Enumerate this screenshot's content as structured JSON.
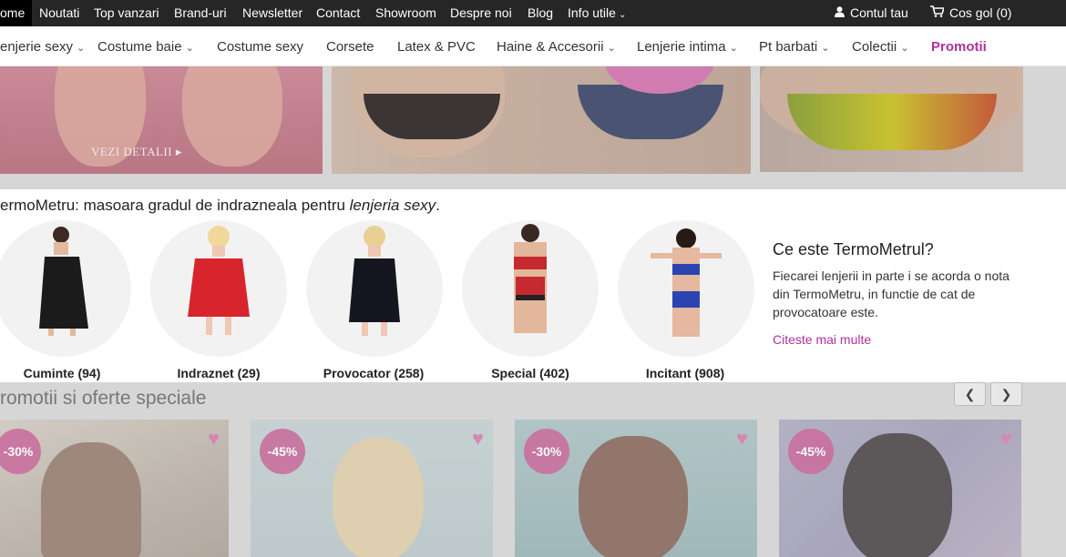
{
  "topbar": {
    "items": [
      "ome",
      "Noutati",
      "Top vanzari",
      "Brand-uri",
      "Newsletter",
      "Contact",
      "Showroom",
      "Despre noi",
      "Blog",
      "Info utile"
    ],
    "account": "Contul tau",
    "cart": "Cos gol (0)"
  },
  "nav": {
    "items": [
      "enjerie sexy",
      "Costume baie",
      "Costume sexy",
      "Corsete",
      "Latex & PVC",
      "Haine & Accesorii",
      "Lenjerie intima",
      "Pt barbati",
      "Colectii",
      "Promotii"
    ]
  },
  "banner": {
    "cta": "VEZI DETALII"
  },
  "thermo": {
    "title_prefix": "ermoMetru: masoara gradul de indrazneala pentru ",
    "title_em": "lenjeria sexy",
    "title_suffix": ".",
    "categories": [
      "Cuminte (94)",
      "Indraznet (29)",
      "Provocator (258)",
      "Special (402)",
      "Incitant (908)"
    ],
    "info": {
      "heading": "Ce este TermoMetrul?",
      "text": "Fiecarei lenjerii in parte i se acorda o nota din TermoMetru, in functie de cat de provocatoare este.",
      "link": "Citeste mai multe"
    }
  },
  "promotions": {
    "title": "romotii si oferte speciale",
    "products": [
      {
        "discount": "-30%"
      },
      {
        "discount": "-45%"
      },
      {
        "discount": "-30%"
      },
      {
        "discount": "-45%"
      }
    ]
  },
  "colors": {
    "accent": "#b1309c",
    "badge": "#c9709e",
    "topbar": "#262626"
  }
}
